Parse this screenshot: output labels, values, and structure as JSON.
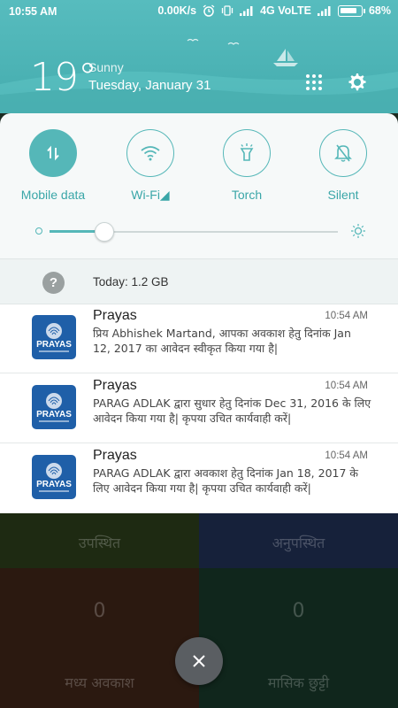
{
  "status_bar": {
    "time": "10:55 AM",
    "net_speed": "0.00K/s",
    "network": "4G VoLTE",
    "battery": "68%"
  },
  "weather": {
    "temperature": "19°",
    "condition": "Sunny",
    "date": "Tuesday, January 31"
  },
  "quick_settings": {
    "tiles": [
      {
        "label": "Mobile data",
        "icon": "mobile-data-icon",
        "active": true
      },
      {
        "label": "Wi-Fi◢",
        "icon": "wifi-icon",
        "active": false
      },
      {
        "label": "Torch",
        "icon": "torch-icon",
        "active": false
      },
      {
        "label": "Silent",
        "icon": "silent-bell-icon",
        "active": false
      }
    ],
    "brightness_fraction": 0.19
  },
  "data_usage": {
    "label": "Today: 1.2 GB"
  },
  "notifications": [
    {
      "app": "Prayas",
      "time": "10:54 AM",
      "body": "प्रिय Abhishek Martand, आपका अवकाश हेतु दिनांक Jan 12, 2017 का आवेदन स्वीकृत किया गया है|"
    },
    {
      "app": "Prayas",
      "time": "10:54 AM",
      "body": "PARAG ADLAK द्वारा सुधार हेतु दिनांक Dec 31, 2016 के लिए आवेदन किया गया है| कृपया उचित कार्यवाही करें|"
    },
    {
      "app": "Prayas",
      "time": "10:54 AM",
      "body": "PARAG ADLAK द्वारा अवकाश हेतु दिनांक Jan 18, 2017 के लिए आवेदन किया गया है| कृपया उचित कार्यवाही करें|"
    }
  ],
  "app_icon_text": "PRAYAS",
  "background_app": {
    "present_label": "उपस्थित",
    "absent_label": "अनुपस्थित",
    "count_left": "0",
    "count_right": "0",
    "mid_leave_label": "मध्य अवकाश",
    "monthly_leave_label": "मासिक छुट्टी"
  },
  "colors": {
    "accent": "#55b7b8",
    "header": "#4cb3b5"
  }
}
